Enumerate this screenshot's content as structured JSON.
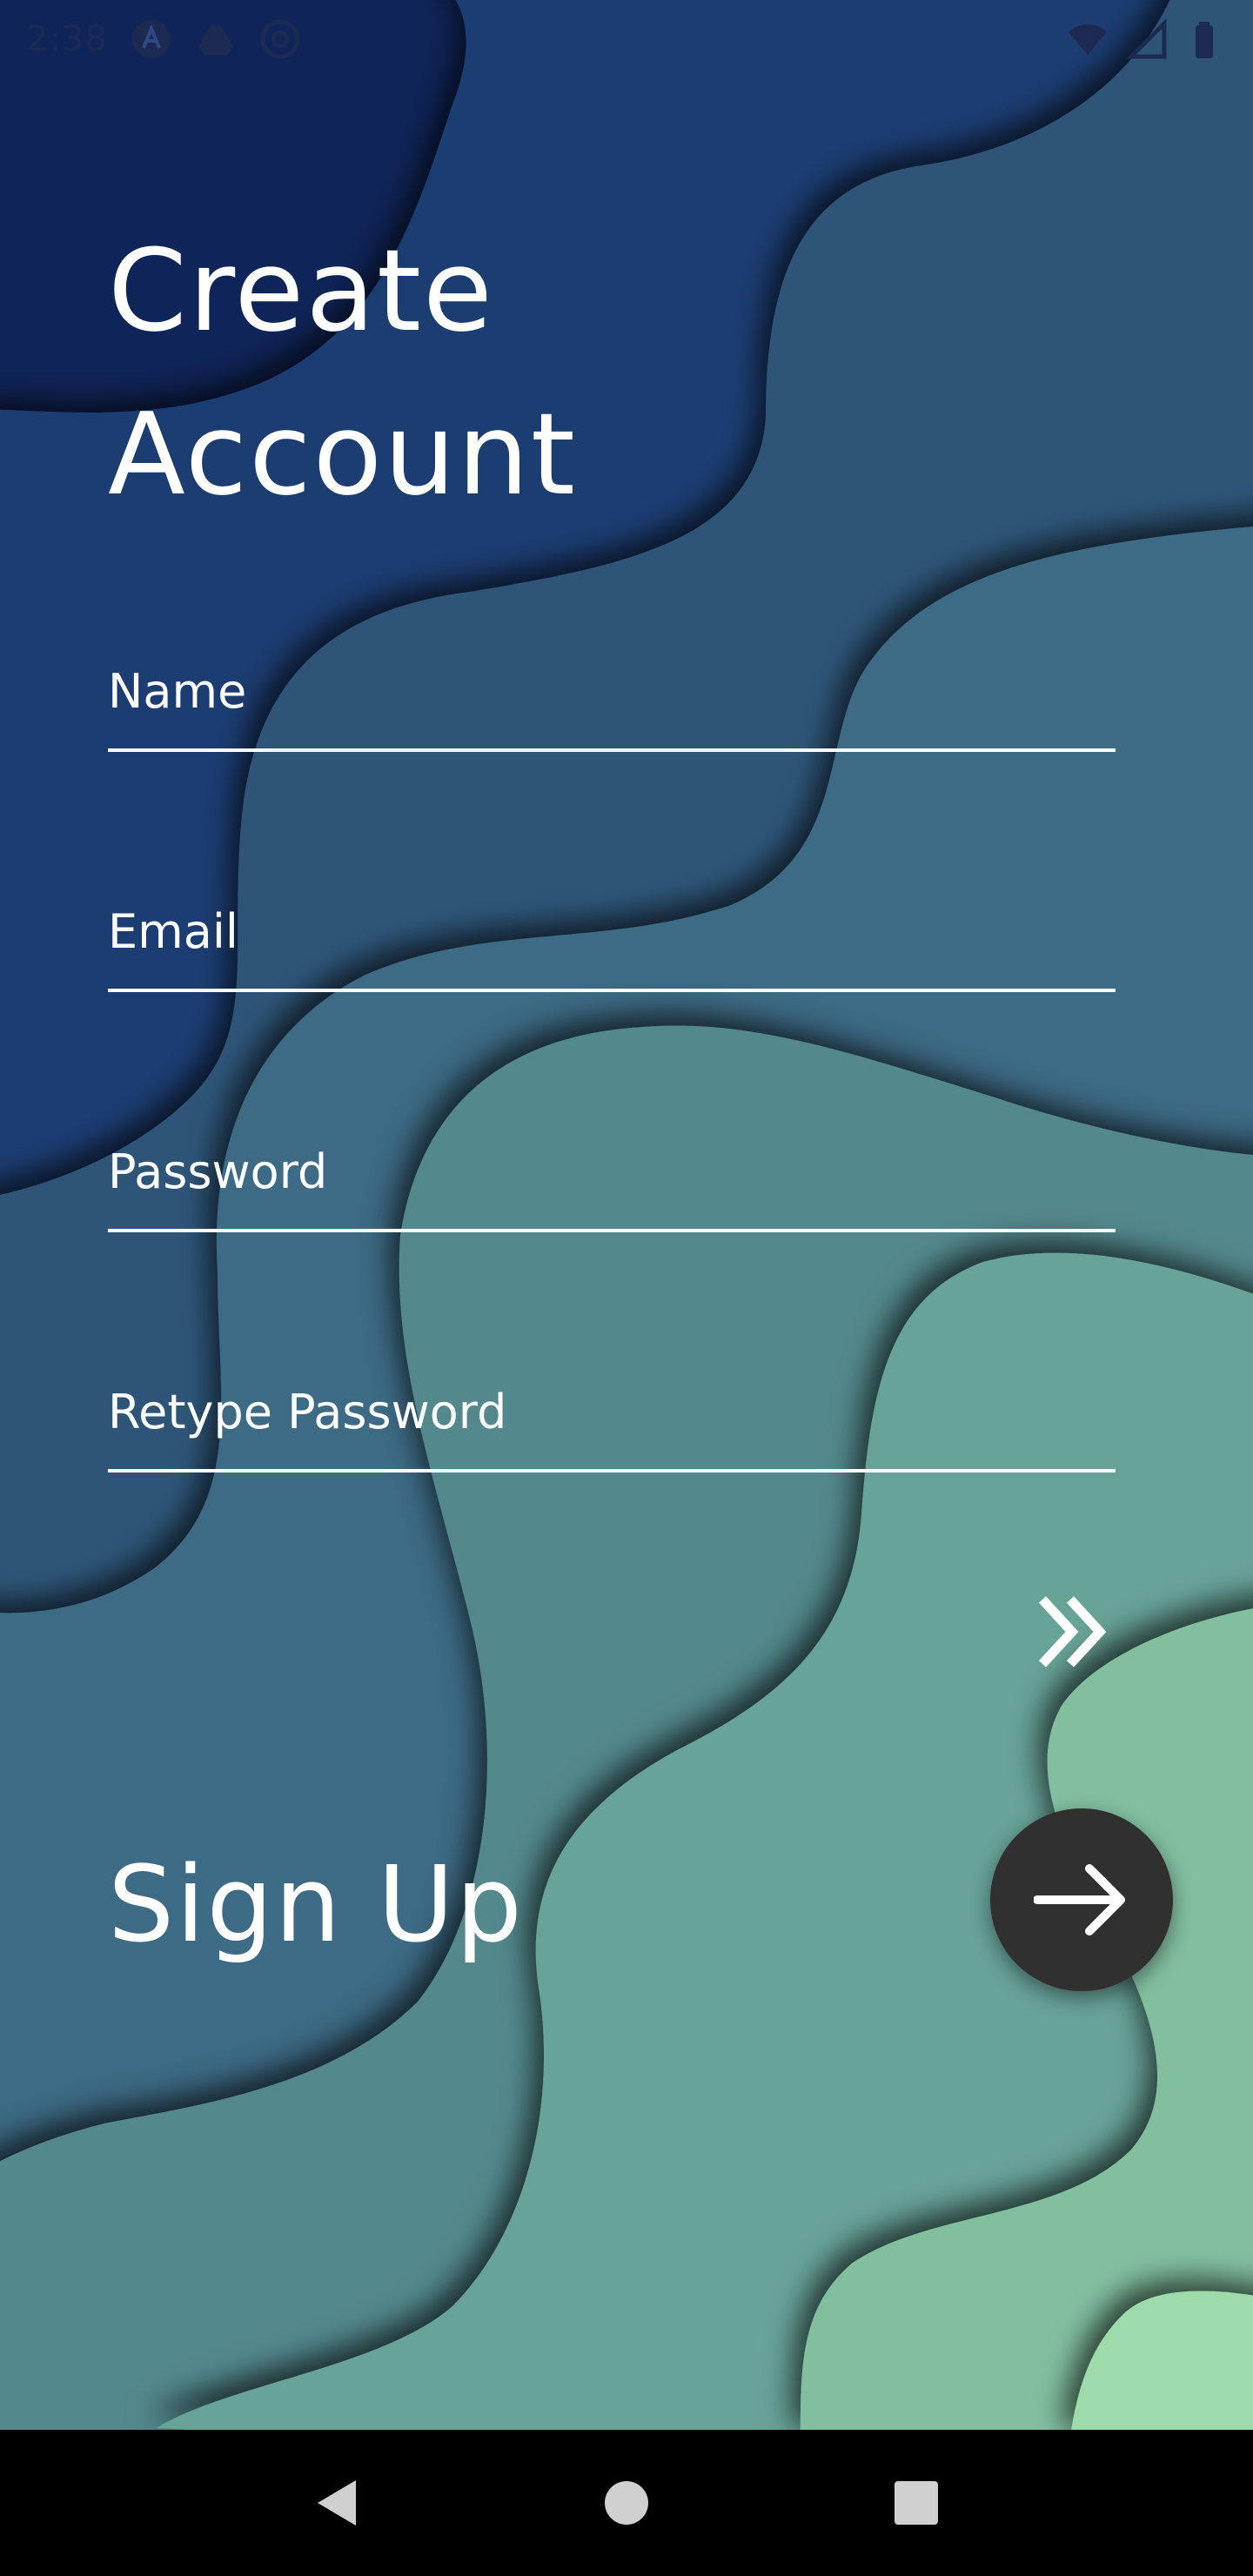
{
  "status_bar": {
    "time": "2:38",
    "left_icons": [
      "app-a-icon",
      "drive-icon",
      "at-sign-icon"
    ],
    "right_icons": [
      "wifi-icon",
      "cellular-signal-icon",
      "battery-icon"
    ]
  },
  "header": {
    "title_line1": "Create",
    "title_line2": "Account"
  },
  "form": {
    "name_placeholder": "Name",
    "name_value": "",
    "email_placeholder": "Email",
    "email_value": "",
    "password_placeholder": "Password",
    "password_value": "",
    "retype_password_placeholder": "Retype Password",
    "retype_password_value": ""
  },
  "actions": {
    "skip_icon": "double-chevron-right-icon",
    "signup_label": "Sign Up",
    "submit_icon": "arrow-right-icon"
  },
  "nav": {
    "back_icon": "back-triangle-icon",
    "home_icon": "home-circle-icon",
    "recents_icon": "recents-square-icon"
  },
  "colors": {
    "wave_dark": "#1a2f66",
    "wave_mid": "#3e6f85",
    "wave_light": "#8fd6a8",
    "button_dark": "#303030"
  }
}
